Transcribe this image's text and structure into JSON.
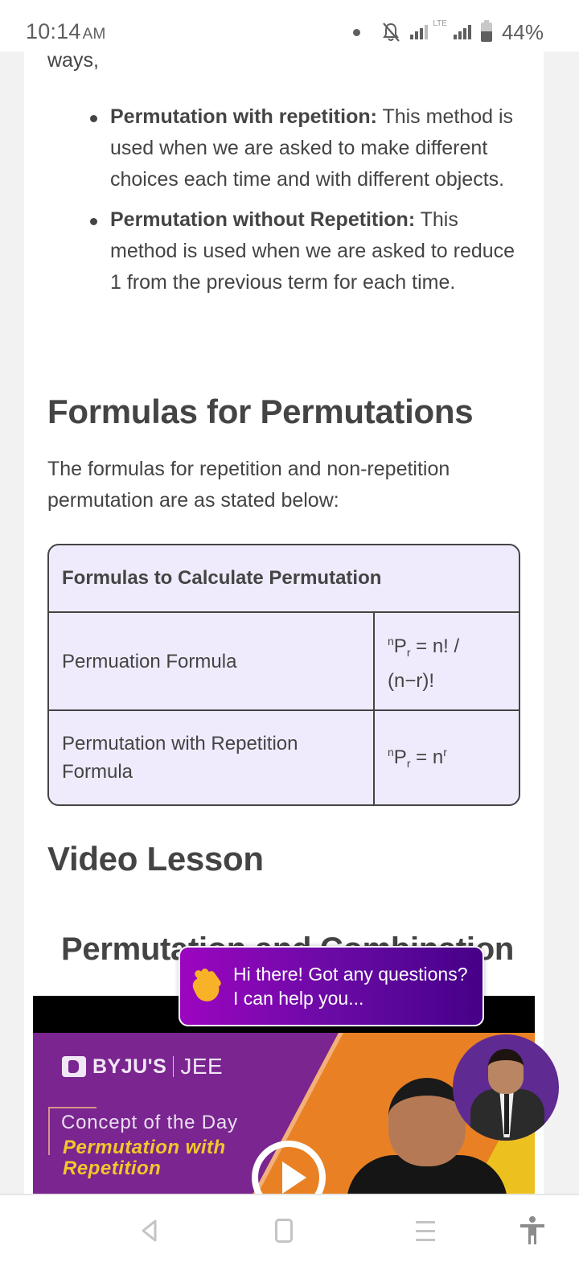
{
  "status_bar": {
    "time": "10:14",
    "ampm": "AM",
    "network": "LTE",
    "battery_percent": "44%",
    "icons": [
      "notification-dot",
      "bell-off-icon",
      "signal-icon",
      "lte-signal-icon",
      "battery-icon"
    ]
  },
  "article": {
    "lead_fragment": "ways,",
    "bullets": [
      {
        "bold": "Permutation with repetition:",
        "text": " This method is used when we are asked to make different choices each time and with different objects."
      },
      {
        "bold": "Permutation without Repetition:",
        "text": " This method is used when we are asked to reduce 1 from the previous term for each time."
      }
    ],
    "formulas_heading": "Formulas for Permutations",
    "formulas_intro": "The formulas for repetition and non-repetition permutation are as stated below:",
    "table": {
      "header": "Formulas to Calculate Permutation",
      "rows": [
        {
          "name": "Permuation Formula",
          "formula": {
            "sup": "n",
            "base": "P",
            "sub": "r",
            "rest": " = n! / (n−r)!"
          }
        },
        {
          "name": "Permutation with Repetition Formula",
          "formula": {
            "sup": "n",
            "base": "P",
            "sub": "r",
            "rest": " = n",
            "exp": "r"
          }
        }
      ]
    },
    "video_heading": "Video Lesson",
    "video_title": "Permutation and Combination"
  },
  "video": {
    "brand_name": "BYJU'S",
    "brand_sub": "JEE",
    "concept_label": "Concept of the Day",
    "concept_title_line1": "Permutation with",
    "concept_title_line2": "Repetition",
    "colors": {
      "purple": "#7a2590",
      "orange": "#e98124",
      "yellow": "#ecc11f",
      "title_yellow": "#f0c82a"
    }
  },
  "chat_popup": {
    "line1": "Hi there! Got any questions?",
    "line2": "I can help you...",
    "gradient": [
      "#9c05c0",
      "#460088"
    ]
  },
  "nav_bar": {
    "buttons": [
      "back",
      "home",
      "recents",
      "accessibility"
    ]
  }
}
